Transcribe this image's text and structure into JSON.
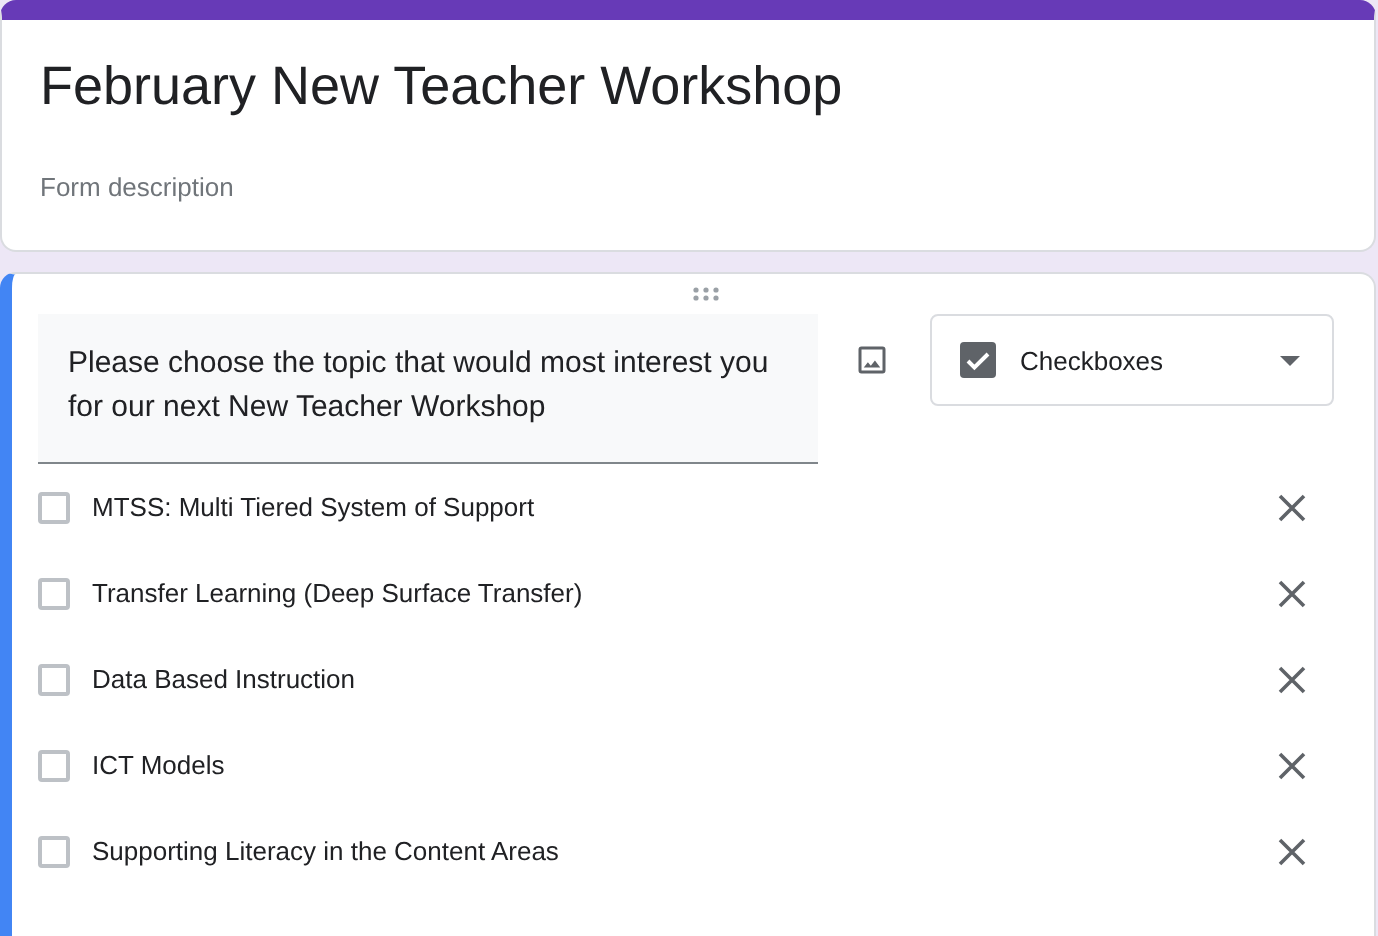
{
  "form": {
    "title": "February New Teacher Workshop",
    "description_placeholder": "Form description"
  },
  "question": {
    "text": "Please choose the topic that would most interest you for our next New Teacher Workshop",
    "type": "Checkboxes",
    "options": [
      {
        "label": "MTSS: Multi Tiered System of Support",
        "checked": false
      },
      {
        "label": "Transfer Learning (Deep Surface Transfer)",
        "checked": false
      },
      {
        "label": "Data Based Instruction",
        "checked": false
      },
      {
        "label": "ICT Models",
        "checked": false
      },
      {
        "label": "Supporting Literacy in the Content Areas",
        "checked": false
      }
    ]
  }
}
